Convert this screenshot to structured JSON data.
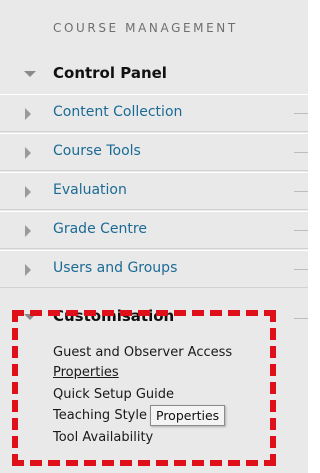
{
  "panel": {
    "header": "COURSE MANAGEMENT",
    "control_panel": "Control Panel",
    "items": [
      {
        "label": "Content Collection"
      },
      {
        "label": "Course Tools"
      },
      {
        "label": "Evaluation"
      },
      {
        "label": "Grade Centre"
      },
      {
        "label": "Users and Groups"
      }
    ],
    "customisation": {
      "label": "Customisation",
      "subitems": [
        {
          "label": "Guest and Observer Access"
        },
        {
          "label": "Properties"
        },
        {
          "label": "Quick Setup Guide"
        },
        {
          "label": "Teaching Style"
        },
        {
          "label": "Tool Availability"
        }
      ]
    }
  },
  "tooltip": "Properties",
  "colors": {
    "link": "#1c6b95",
    "highlight": "#e0101a",
    "panel_bg": "#e9e9e9"
  }
}
